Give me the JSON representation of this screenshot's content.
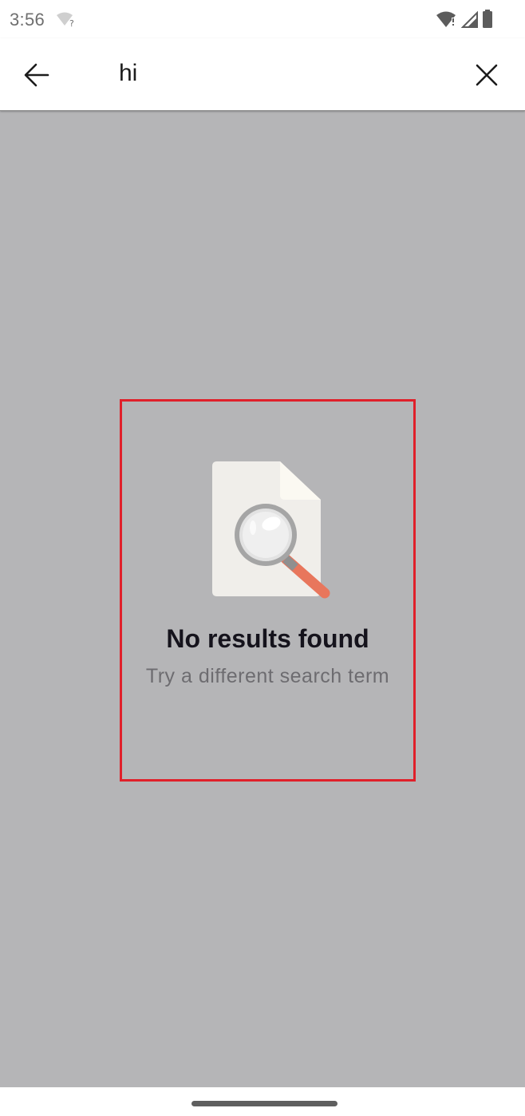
{
  "status_bar": {
    "time": "3:56",
    "icons": [
      "wifi-unknown-icon",
      "wifi-alert-icon",
      "cellular-signal-icon",
      "battery-icon"
    ]
  },
  "app_bar": {
    "back_icon": "arrow-left-icon",
    "search_value": "hi",
    "clear_icon": "close-icon"
  },
  "empty_state": {
    "illustration": "document-magnifier-illustration",
    "title": "No results found",
    "subtitle": "Try a different search term"
  },
  "colors": {
    "content_background": "#b5b5b7",
    "highlight_border": "#e0202a",
    "title_text": "#15131c",
    "subtitle_text": "#6d6c70",
    "magnifier_handle": "#e8765c"
  }
}
